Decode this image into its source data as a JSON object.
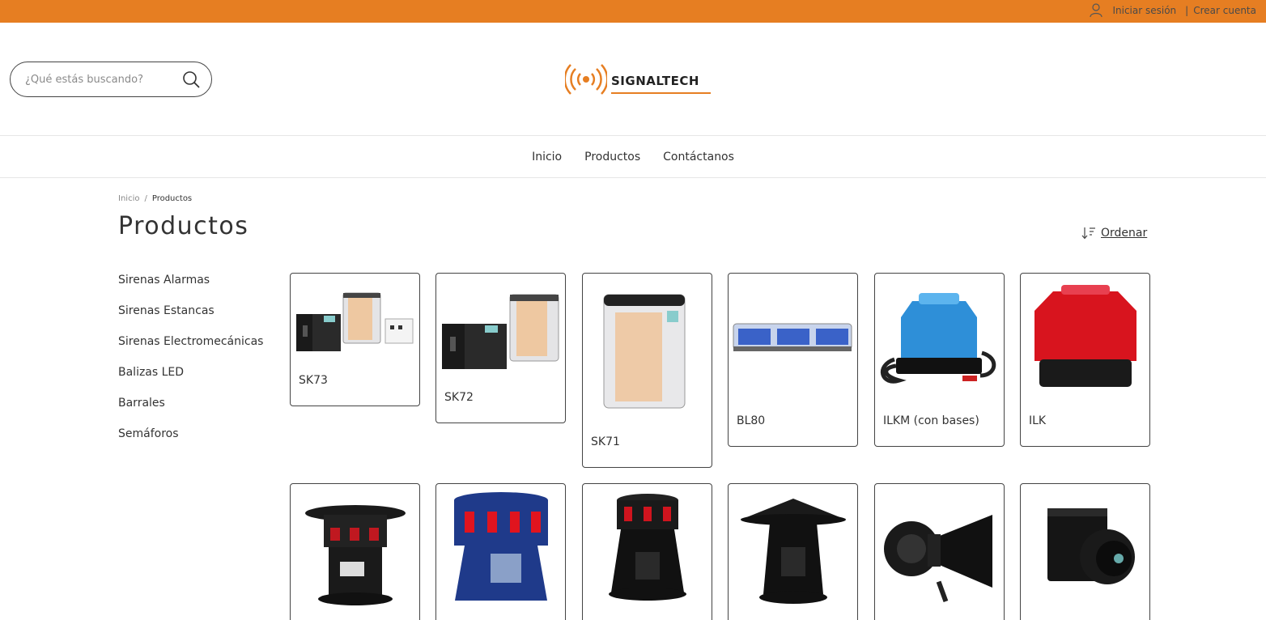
{
  "topbar": {
    "login_label": "Iniciar sesión",
    "separator": "|",
    "signup_label": "Crear cuenta",
    "icon": "user-icon",
    "color": "#e67e22"
  },
  "header": {
    "search": {
      "placeholder": "¿Qué estás buscando?",
      "value": "",
      "icon": "search-icon"
    },
    "logo": {
      "text": "SIGNALTECH",
      "icon": "signal-waves-icon",
      "accent": "#e67e22"
    }
  },
  "nav": {
    "items": [
      {
        "label": "Inicio"
      },
      {
        "label": "Productos"
      },
      {
        "label": "Contáctanos"
      }
    ]
  },
  "breadcrumb": {
    "home": "Inicio",
    "separator": "/",
    "current": "Productos"
  },
  "page": {
    "title": "Productos",
    "sort_label": "Ordenar",
    "sort_icon": "sort-icon"
  },
  "sidebar": {
    "categories": [
      {
        "label": "Sirenas Alarmas"
      },
      {
        "label": "Sirenas Estancas"
      },
      {
        "label": "Sirenas Electromecánicas"
      },
      {
        "label": "Balizas LED"
      },
      {
        "label": "Barrales"
      },
      {
        "label": "Semáforos"
      }
    ]
  },
  "products": [
    {
      "name": "SK73",
      "image": "siren-box-set-image"
    },
    {
      "name": "SK72",
      "image": "siren-box-pair-image"
    },
    {
      "name": "SK71",
      "image": "siren-box-tall-image"
    },
    {
      "name": "BL80",
      "image": "blue-lightbar-image"
    },
    {
      "name": "ILKM (con bases)",
      "image": "blue-beacon-image"
    },
    {
      "name": "ILK",
      "image": "red-beacon-image"
    },
    {
      "name": "",
      "image": "electromechanical-siren-hood-image"
    },
    {
      "name": "",
      "image": "blue-electromechanical-siren-image"
    },
    {
      "name": "",
      "image": "black-siren-red-lights-image"
    },
    {
      "name": "",
      "image": "siren-with-hood-image"
    },
    {
      "name": "",
      "image": "horn-siren-image"
    },
    {
      "name": "",
      "image": "box-siren-horn-image"
    }
  ]
}
